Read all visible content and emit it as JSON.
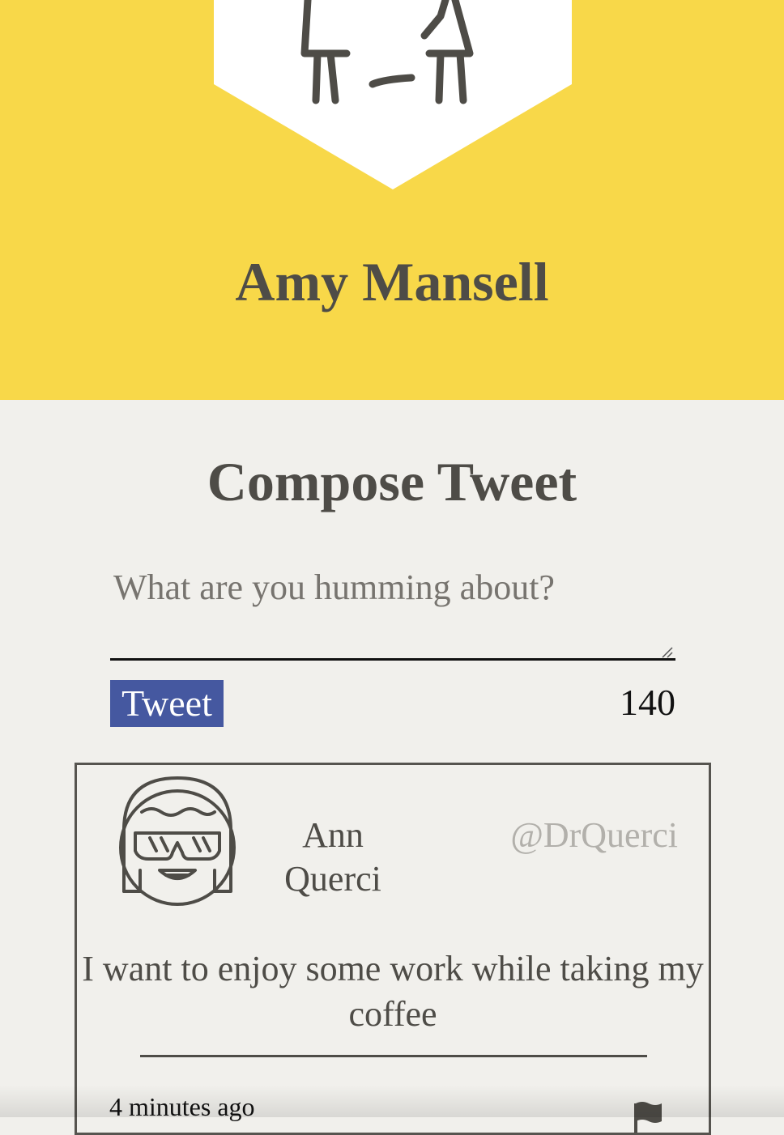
{
  "profile": {
    "name": "Amy Mansell",
    "avatar_icon": "person-avatar-icon",
    "header_color": "#f8d849"
  },
  "compose": {
    "title": "Compose Tweet",
    "placeholder": "What are you humming about?",
    "value": "",
    "button_label": "Tweet",
    "char_count": "140",
    "button_color": "#4558a0"
  },
  "tweets": [
    {
      "avatar_icon": "woman-with-glasses-avatar-icon",
      "author_name": "Ann Querci",
      "handle": "@DrQuerci",
      "content": "I want to enjoy some work while taking my coffee",
      "timestamp": "4 minutes ago",
      "flag_icon": "flag-icon"
    }
  ]
}
